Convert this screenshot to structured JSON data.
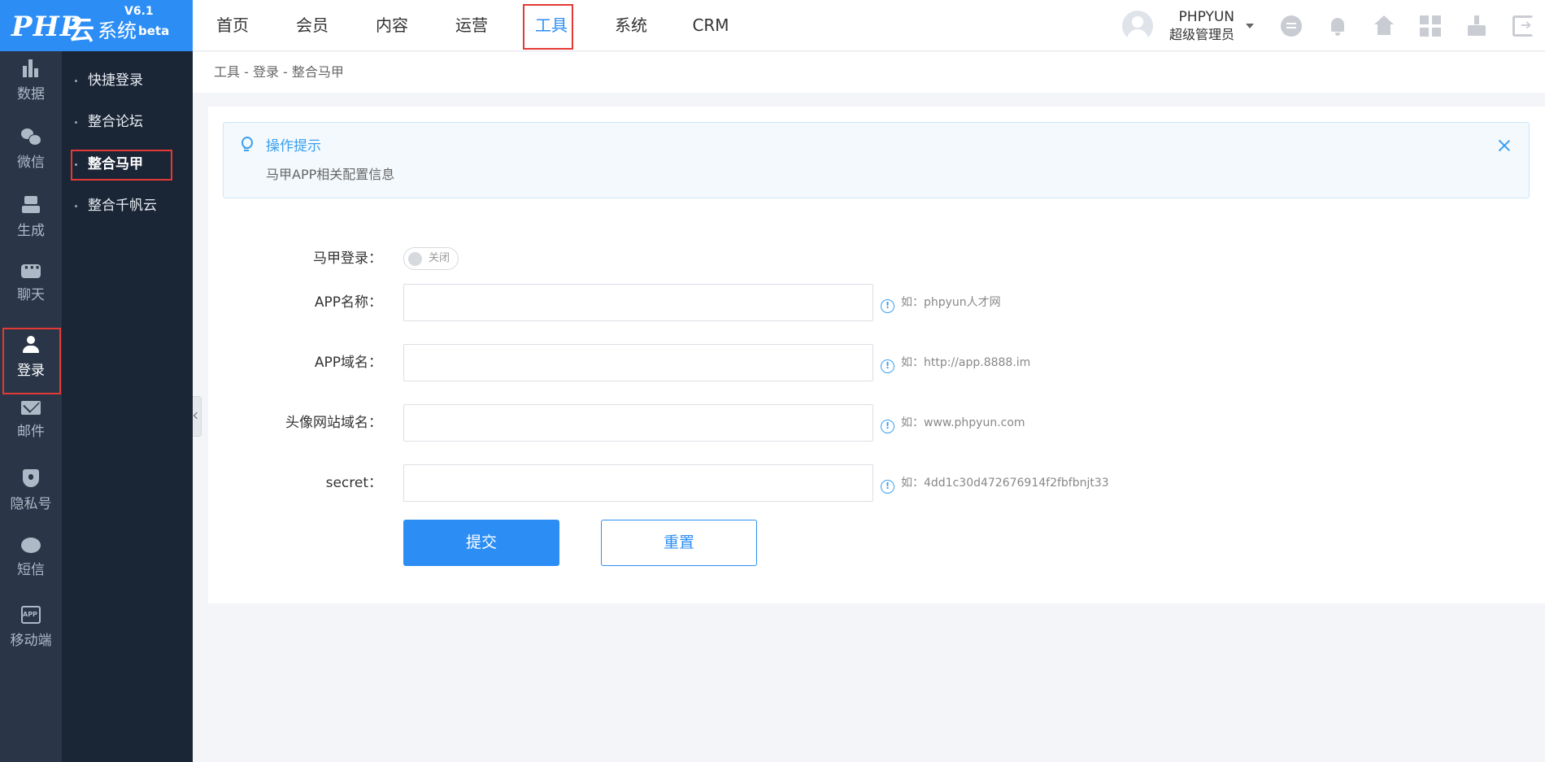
{
  "logo": {
    "php": "PHP",
    "yun": "云",
    "sys": "系统",
    "version": "V6.1",
    "beta": "beta"
  },
  "topnav": [
    {
      "label": "首页"
    },
    {
      "label": "会员"
    },
    {
      "label": "内容"
    },
    {
      "label": "运营"
    },
    {
      "label": "工具",
      "active": true
    },
    {
      "label": "系统"
    },
    {
      "label": "CRM"
    }
  ],
  "user": {
    "name": "PHPYUN",
    "role": "超级管理员"
  },
  "toolbar_icons": [
    "message-icon",
    "bell-icon",
    "home-icon",
    "apps-icon",
    "clean-icon",
    "logout-icon"
  ],
  "iconbar": [
    {
      "label": "数据",
      "icon": "bar-chart-icon"
    },
    {
      "label": "微信",
      "icon": "wechat-icon"
    },
    {
      "label": "生成",
      "icon": "generate-icon"
    },
    {
      "label": "聊天",
      "icon": "chat-icon"
    },
    {
      "label": "登录",
      "icon": "user-icon",
      "active": true
    },
    {
      "label": "邮件",
      "icon": "mail-icon"
    },
    {
      "label": "隐私号",
      "icon": "shield-icon"
    },
    {
      "label": "短信",
      "icon": "sms-icon"
    },
    {
      "label": "移动端",
      "icon": "mobile-icon"
    }
  ],
  "submenu": [
    {
      "label": "快捷登录"
    },
    {
      "label": "整合论坛"
    },
    {
      "label": "整合马甲",
      "active": true
    },
    {
      "label": "整合千帆云"
    }
  ],
  "breadcrumb": "工具 - 登录 - 整合马甲",
  "tip": {
    "title": "操作提示",
    "text": "马甲APP相关配置信息"
  },
  "form": {
    "toggle": {
      "label": "马甲登录：",
      "state": "关闭"
    },
    "app_name": {
      "label": "APP名称：",
      "value": "",
      "hint": "如：phpyun人才网"
    },
    "app_domain": {
      "label": "APP域名：",
      "value": "",
      "hint": "如：http://app.8888.im"
    },
    "avatar_domain": {
      "label": "头像网站域名：",
      "value": "",
      "hint": "如：www.phpyun.com"
    },
    "secret": {
      "label": "secret：",
      "value": "",
      "hint": "如：4dd1c30d472676914f2fbfbnjt33"
    },
    "submit_label": "提交",
    "reset_label": "重置"
  },
  "colors": {
    "brand": "#2c8ef5",
    "sidebar": "#2a3647",
    "submenu": "#1a2535",
    "highlight": "#e53935"
  }
}
